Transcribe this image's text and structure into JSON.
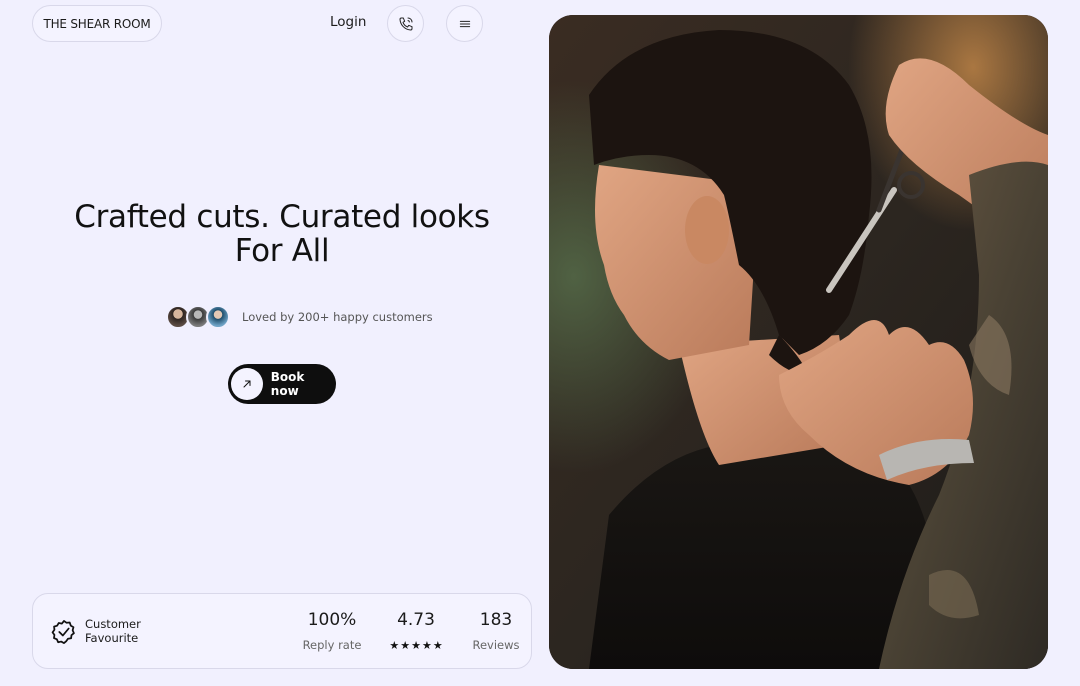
{
  "header": {
    "brand": "THE SHEAR ROOM",
    "login_label": "Login",
    "phone_icon": "phone-icon",
    "menu_icon": "menu-icon"
  },
  "hero": {
    "title_line1": "Crafted cuts. Curated looks",
    "title_line2": "For All",
    "loved_text": "Loved by 200+ happy customers",
    "book_label": "Book now",
    "book_icon": "arrow-up-right-icon"
  },
  "stats": {
    "badge_icon": "verified-badge-icon",
    "badge_line1": "Customer",
    "badge_line2": "Favourite",
    "reply_rate_value": "100%",
    "reply_rate_label": "Reply rate",
    "rating_value": "4.73",
    "rating_stars": 5,
    "reviews_value": "183",
    "reviews_label": "Reviews"
  },
  "colors": {
    "background": "#f1f0fe",
    "button_dark": "#0e0e0e"
  }
}
